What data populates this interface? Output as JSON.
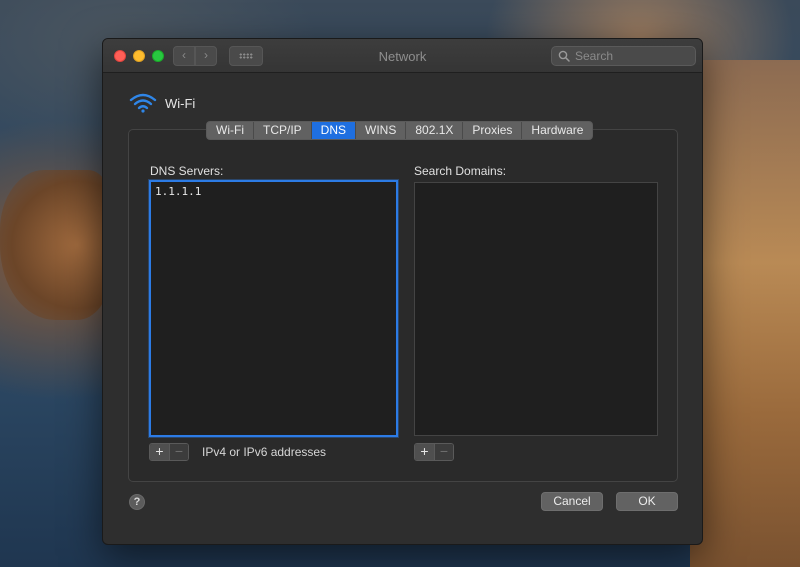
{
  "window": {
    "title": "Network",
    "search_placeholder": "Search"
  },
  "toolbar": {
    "back_glyph": "‹",
    "forward_glyph": "›",
    "grid_icon": "grid-icon"
  },
  "connection": {
    "icon": "wifi-icon",
    "name": "Wi-Fi"
  },
  "tabs": [
    {
      "label": "Wi-Fi",
      "active": false
    },
    {
      "label": "TCP/IP",
      "active": false
    },
    {
      "label": "DNS",
      "active": true
    },
    {
      "label": "WINS",
      "active": false
    },
    {
      "label": "802.1X",
      "active": false
    },
    {
      "label": "Proxies",
      "active": false
    },
    {
      "label": "Hardware",
      "active": false
    }
  ],
  "dns": {
    "servers_label": "DNS Servers:",
    "servers": [
      "1.1.1.1"
    ],
    "hint": "IPv4 or IPv6 addresses",
    "domains_label": "Search Domains:",
    "domains": []
  },
  "controls": {
    "add_glyph": "+",
    "remove_glyph": "−",
    "help_glyph": "?"
  },
  "buttons": {
    "cancel": "Cancel",
    "ok": "OK"
  },
  "colors": {
    "accent": "#1f6fe0",
    "focus_ring": "#2c7be5",
    "close": "#ff5f57",
    "minimize": "#febc2e",
    "maximize": "#28c840"
  }
}
